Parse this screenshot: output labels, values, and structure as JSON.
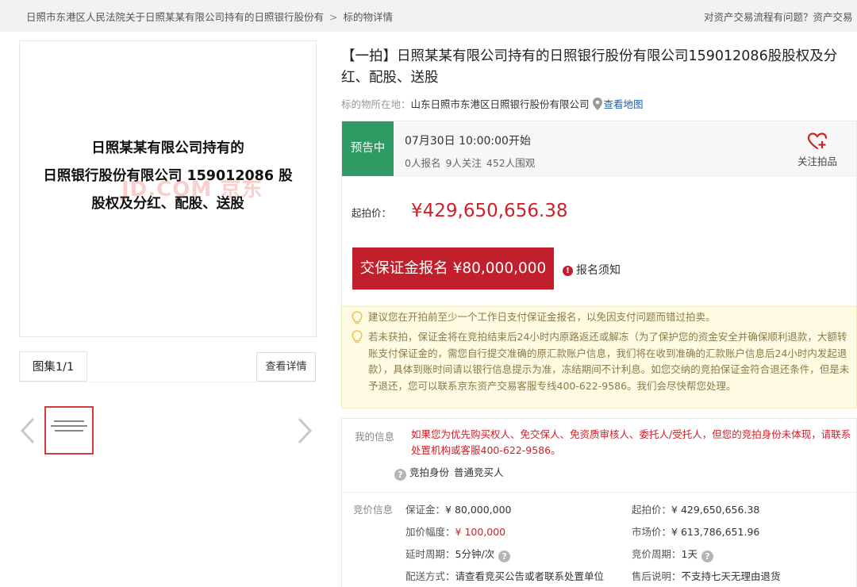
{
  "breadcrumb": {
    "court_item": "日照市东港区人民法院关于日照某某有限公司持有的日照银行股份有",
    "separator": ">",
    "current": "标的物详情"
  },
  "top_link": "对资产交易流程有问题？资产交易",
  "gallery": {
    "main_image_lines": [
      "日照某某有限公司持有的",
      "日照银行股份有限公司 159012086 股",
      "股权及分红、配股、送股"
    ],
    "watermark": "JD.COM 京东",
    "tab_label": "图集1/1",
    "detail_button": "查看详情"
  },
  "item": {
    "title": "【一拍】日照某某有限公司持有的日照银行股份有限公司159012086股股权及分红、配股、送股",
    "location_label": "标的物所在地：",
    "location_value": "山东日照市东港区日照银行股份有限公司",
    "map_link": "查看地图"
  },
  "status": {
    "tag": "预告中",
    "start_time": "07月30日 10:00:00开始",
    "signups": "0人报名",
    "followers": "9人关注",
    "watchers": "452人围观",
    "follow_label": "关注拍品"
  },
  "price": {
    "label": "起拍价：",
    "value": "¥429,650,656.38",
    "deposit_button": "交保证金报名 ¥80,000,000",
    "notice_link": "报名须知"
  },
  "tips": [
    "建议您在开拍前至少一个工作日支付保证金报名，以免因支付问题而错过拍卖。",
    "若未获拍，保证金将在竞拍结束后24小时内原路返还或解冻（为了保护您的资金安全并确保顺利退款，大额转账支付保证金的，需您自行提交准确的原汇款账户信息，我们将在收到准确的汇款账户信息后24小时内发起退款），具体到账时间请以银行信息提示为准，冻结期间不计利息。如您交纳的竞拍保证金符合退还条件，但是未予退还，您可以联系京东资产交易客服专线400-622-9586。我们会尽快帮您处理。"
  ],
  "my_info": {
    "label": "我的信息",
    "message": "如果您为优先购买权人、免交保人、免资质审核人、委托人/受托人，但您的竞拍身份未体现，请联系处置机构或客服400-622-9586。",
    "identity_label": "竞拍身份",
    "identity_value": "普通竞买人"
  },
  "bid_info": {
    "label": "竞价信息",
    "deposit_k": "保证金：",
    "deposit_v": "¥ 80,000,000",
    "start_k": "起拍价：",
    "start_v": "¥ 429,650,656.38",
    "increment_k": "加价幅度：",
    "increment_v": "¥ 100,000",
    "market_k": "市场价：",
    "market_v": "¥ 613,786,651.96",
    "delay_k": "延时周期：",
    "delay_v": "5分钟/次",
    "cycle_k": "竞价周期：",
    "cycle_v": "1天",
    "delivery_k": "配送方式：",
    "delivery_v": "请查看竞买公告或者联系处置单位",
    "aftersale_k": "售后说明：",
    "aftersale_v": "不支持七天无理由退货"
  },
  "colors": {
    "accent_red": "#c11f2b",
    "price_red": "#d0202a",
    "status_green": "#2f9a64",
    "link_blue": "#1a5fb4",
    "tip_background": "#fffbe3"
  },
  "icons": [
    "location-pin-icon",
    "heart-plus-icon",
    "alert-circle-icon",
    "lightbulb-icon",
    "question-icon",
    "chevron-left-icon",
    "chevron-right-icon"
  ]
}
